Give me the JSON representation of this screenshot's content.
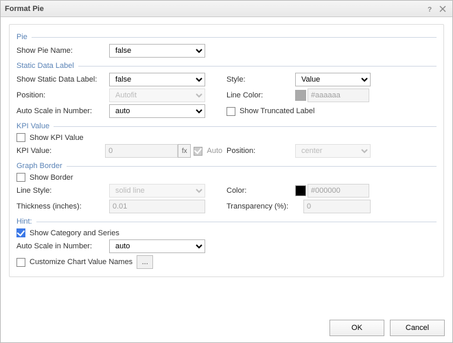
{
  "window": {
    "title": "Format Pie"
  },
  "sections": {
    "pie": "Pie",
    "static_label": "Static Data Label",
    "kpi": "KPI Value",
    "border": "Graph Border",
    "hint": "Hint:"
  },
  "labels": {
    "show_pie_name": "Show Pie Name:",
    "show_static_label": "Show Static Data Label:",
    "position": "Position:",
    "auto_scale": "Auto Scale in Number:",
    "style": "Style:",
    "line_color": "Line Color:",
    "show_trunc": "Show Truncated Label",
    "show_kpi": "Show KPI Value",
    "kpi_value": "KPI Value:",
    "auto": "Auto",
    "kpi_position": "Position:",
    "show_border": "Show Border",
    "line_style": "Line Style:",
    "thickness": "Thickness (inches):",
    "color": "Color:",
    "transparency": "Transparency (%):",
    "show_cat": "Show Category and Series",
    "auto_scale2": "Auto Scale in Number:",
    "customize_names": "Customize Chart Value Names",
    "ok": "OK",
    "cancel": "Cancel"
  },
  "values": {
    "show_pie_name": "false",
    "show_static_label": "false",
    "position": "Autofit",
    "auto_scale": "auto",
    "style": "Value",
    "line_color": "#aaaaaa",
    "kpi_value": "0",
    "kpi_position": "center",
    "line_style": "solid line",
    "thickness": "0.01",
    "color": "#000000",
    "transparency": "0",
    "auto_scale2": "auto",
    "ellipsis": "..."
  },
  "colors": {
    "line_color_swatch": "#aaaaaa",
    "color_swatch": "#000000"
  }
}
